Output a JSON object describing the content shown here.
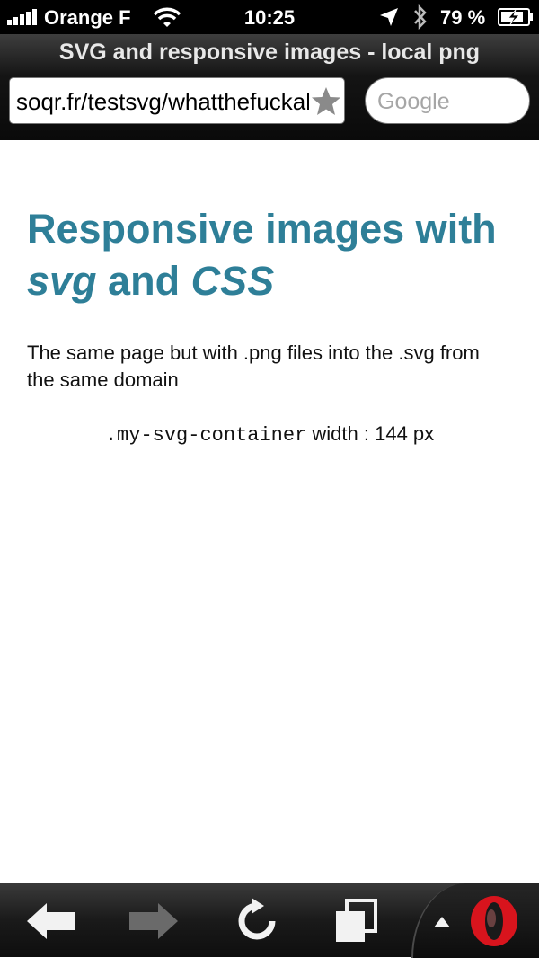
{
  "status_bar": {
    "carrier": "Orange F",
    "time": "10:25",
    "battery_percent": "79 %",
    "icons": [
      "signal-icon",
      "wifi-icon",
      "location-icon",
      "bluetooth-icon",
      "battery-charging-icon"
    ]
  },
  "browser": {
    "page_title": "SVG and responsive images - local png",
    "url": "soqr.fr/testsvg/whatthefuckallt",
    "search_placeholder": "Google"
  },
  "page": {
    "heading_part1": "Responsive images with ",
    "heading_em1": "svg",
    "heading_part2": " and ",
    "heading_em2": "CSS",
    "intro": "The same page but with .png files into the .svg from the same domain",
    "code_selector": ".my-svg-container",
    "width_text": "width : 144 px"
  },
  "bottom_bar": {
    "buttons": [
      "back-icon",
      "forward-icon",
      "reload-icon",
      "tabs-icon",
      "opera-menu-icon"
    ]
  },
  "colors": {
    "heading": "#2e7f98",
    "opera_red": "#d8141d"
  }
}
